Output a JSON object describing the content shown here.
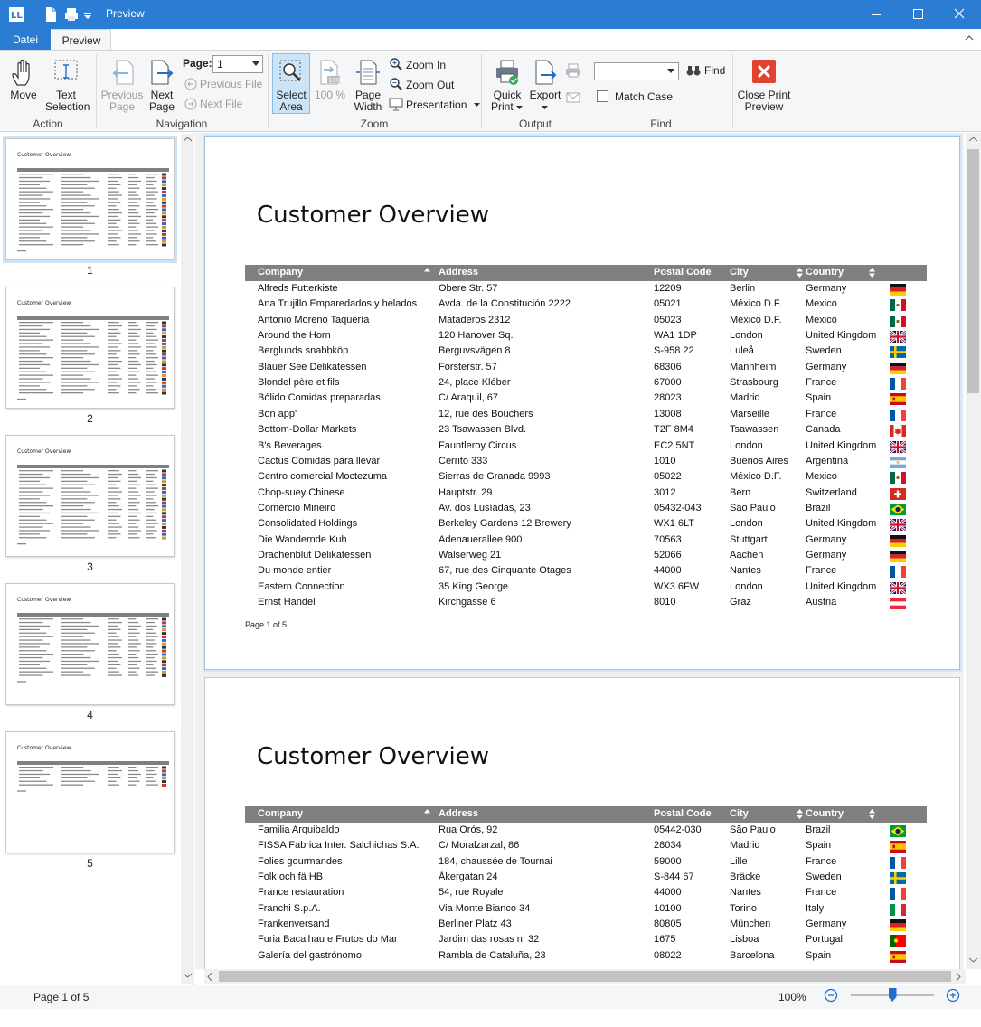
{
  "title": "Preview",
  "tabs": [
    {
      "label": "Datei"
    },
    {
      "label": "Preview"
    }
  ],
  "ribbon": {
    "move": "Move",
    "text_selection": "Text Selection",
    "previous_page": "Previous Page",
    "next_page": "Next Page",
    "page_label": "Page:",
    "page_value": "1",
    "previous_file": "Previous File",
    "next_file": "Next File",
    "select_area": "Select Area",
    "zoom_100": "100 %",
    "page_width": "Page Width",
    "zoom_in": "Zoom In",
    "zoom_out": "Zoom Out",
    "presentation": "Presentation",
    "quick_print": "Quick Print",
    "export": "Export",
    "find": "Find",
    "match_case": "Match Case",
    "close_print_preview": "Close Print Preview",
    "groups": [
      "Action",
      "Navigation",
      "Zoom",
      "Output",
      "Find"
    ]
  },
  "report": {
    "title": "Customer Overview",
    "columns": [
      "Company",
      "Address",
      "Postal Code",
      "City",
      "Country"
    ],
    "pages": [
      {
        "footer": "Page 1 of 5",
        "rows": [
          [
            "Alfreds Futterkiste",
            "Obere Str. 57",
            "12209",
            "Berlin",
            "Germany",
            "de"
          ],
          [
            "Ana Trujillo Emparedados y helados",
            "Avda. de la Constitución 2222",
            "05021",
            "México D.F.",
            "Mexico",
            "mx"
          ],
          [
            "Antonio Moreno Taquería",
            "Mataderos 2312",
            "05023",
            "México D.F.",
            "Mexico",
            "mx"
          ],
          [
            "Around the Horn",
            "120 Hanover Sq.",
            "WA1 1DP",
            "London",
            "United Kingdom",
            "gb"
          ],
          [
            "Berglunds snabbköp",
            "Berguvsvägen 8",
            "S-958 22",
            "Luleå",
            "Sweden",
            "se"
          ],
          [
            "Blauer See Delikatessen",
            "Forsterstr. 57",
            "68306",
            "Mannheim",
            "Germany",
            "de"
          ],
          [
            "Blondel père et fils",
            "24, place Kléber",
            "67000",
            "Strasbourg",
            "France",
            "fr"
          ],
          [
            "Bólido Comidas preparadas",
            "C/ Araquil, 67",
            "28023",
            "Madrid",
            "Spain",
            "es"
          ],
          [
            "Bon app'",
            "12, rue des Bouchers",
            "13008",
            "Marseille",
            "France",
            "fr"
          ],
          [
            "Bottom-Dollar Markets",
            "23 Tsawassen Blvd.",
            "T2F 8M4",
            "Tsawassen",
            "Canada",
            "ca"
          ],
          [
            "B's Beverages",
            "Fauntleroy Circus",
            "EC2 5NT",
            "London",
            "United Kingdom",
            "gb"
          ],
          [
            "Cactus Comidas para llevar",
            "Cerrito 333",
            "1010",
            "Buenos Aires",
            "Argentina",
            "ar"
          ],
          [
            "Centro comercial Moctezuma",
            "Sierras de Granada 9993",
            "05022",
            "México D.F.",
            "Mexico",
            "mx"
          ],
          [
            "Chop-suey Chinese",
            "Hauptstr. 29",
            "3012",
            "Bern",
            "Switzerland",
            "ch"
          ],
          [
            "Comércio Mineiro",
            "Av. dos Lusíadas, 23",
            "05432-043",
            "São Paulo",
            "Brazil",
            "br"
          ],
          [
            "Consolidated Holdings",
            "Berkeley Gardens 12 Brewery",
            "WX1 6LT",
            "London",
            "United Kingdom",
            "gb"
          ],
          [
            "Die Wandernde Kuh",
            "Adenauerallee 900",
            "70563",
            "Stuttgart",
            "Germany",
            "de"
          ],
          [
            "Drachenblut Delikatessen",
            "Walserweg 21",
            "52066",
            "Aachen",
            "Germany",
            "de"
          ],
          [
            "Du monde entier",
            "67, rue des Cinquante Otages",
            "44000",
            "Nantes",
            "France",
            "fr"
          ],
          [
            "Eastern Connection",
            "35 King George",
            "WX3 6FW",
            "London",
            "United Kingdom",
            "gb"
          ],
          [
            "Ernst Handel",
            "Kirchgasse 6",
            "8010",
            "Graz",
            "Austria",
            "at"
          ]
        ]
      },
      {
        "footer": "",
        "rows": [
          [
            "Familia Arquibaldo",
            "Rua Orós, 92",
            "05442-030",
            "São Paulo",
            "Brazil",
            "br"
          ],
          [
            "FISSA Fabrica Inter. Salchichas S.A.",
            "C/ Moralzarzal, 86",
            "28034",
            "Madrid",
            "Spain",
            "es"
          ],
          [
            "Folies gourmandes",
            "184, chaussée de Tournai",
            "59000",
            "Lille",
            "France",
            "fr"
          ],
          [
            "Folk och fä HB",
            "Åkergatan 24",
            "S-844 67",
            "Bräcke",
            "Sweden",
            "se"
          ],
          [
            "France restauration",
            "54, rue Royale",
            "44000",
            "Nantes",
            "France",
            "fr"
          ],
          [
            "Franchi S.p.A.",
            "Via Monte Bianco 34",
            "10100",
            "Torino",
            "Italy",
            "it"
          ],
          [
            "Frankenversand",
            "Berliner Platz 43",
            "80805",
            "München",
            "Germany",
            "de"
          ],
          [
            "Furia Bacalhau e Frutos do Mar",
            "Jardim das rosas n. 32",
            "1675",
            "Lisboa",
            "Portugal",
            "pt"
          ],
          [
            "Galería del gastrónomo",
            "Rambla de Cataluña, 23",
            "08022",
            "Barcelona",
            "Spain",
            "es"
          ]
        ]
      }
    ]
  },
  "thumbnails": [
    {
      "label": "1",
      "title": "Customer Overview"
    },
    {
      "label": "2",
      "title": "Customer Overview"
    },
    {
      "label": "3",
      "title": "Customer Overview"
    },
    {
      "label": "4",
      "title": "Customer Overview"
    },
    {
      "label": "5",
      "title": "Customer Overview"
    }
  ],
  "status": {
    "page": "Page 1 of 5",
    "zoom": "100%",
    "zoom_level_pct": 50
  },
  "colors": {
    "titlebar": "#2b7cd3",
    "header": "#808080",
    "accent": "#1e6fcc",
    "close_red": "#e0432f"
  }
}
